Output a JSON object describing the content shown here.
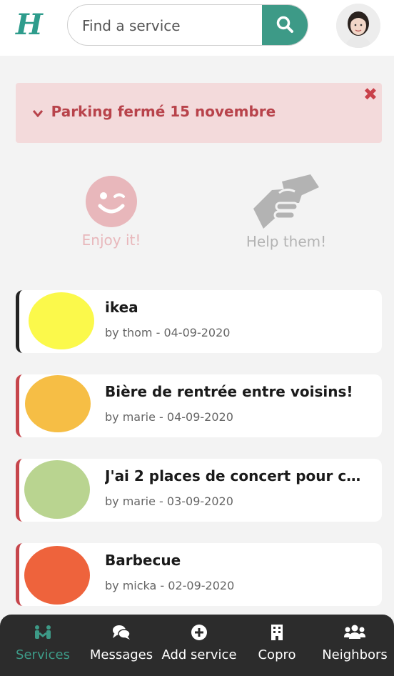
{
  "header": {
    "logo_text": "H",
    "search": {
      "placeholder": "Find a service",
      "value": ""
    },
    "search_icon": "search-icon",
    "avatar": "user-avatar"
  },
  "alert": {
    "text": "Parking fermé 15 novembre",
    "chevron": "❯",
    "close": "✖",
    "bg_color": "#f3dadb",
    "text_color": "#b8434b"
  },
  "actions": [
    {
      "label": "Enjoy it!",
      "icon": "smile-wink-icon",
      "color": "#e8b7bb"
    },
    {
      "label": "Help them!",
      "icon": "handshake-icon",
      "color": "#b3b3b3"
    }
  ],
  "services": [
    {
      "title": "ikea",
      "meta": "by thom - 04-09-2020",
      "blob_color": "#fbf94b",
      "bar_color": "#222222"
    },
    {
      "title": "Bière de rentrée entre voisins!",
      "meta": "by marie - 04-09-2020",
      "blob_color": "#f6be45",
      "bar_color": "#c6454b"
    },
    {
      "title": "J'ai 2 places de concert pour ce ...",
      "meta": "by marie - 03-09-2020",
      "blob_color": "#b9d490",
      "bar_color": "#c6454b"
    },
    {
      "title": "Barbecue",
      "meta": "by micka - 02-09-2020",
      "blob_color": "#ee633c",
      "bar_color": "#c6454b"
    }
  ],
  "nav": {
    "items": [
      {
        "label": "Services",
        "icon": "services-icon",
        "active": true
      },
      {
        "label": "Messages",
        "icon": "comments-icon",
        "active": false
      },
      {
        "label": "Add service",
        "icon": "plus-circle-icon",
        "active": false
      },
      {
        "label": "Copro",
        "icon": "building-icon",
        "active": false
      },
      {
        "label": "Neighbors",
        "icon": "users-icon",
        "active": false
      }
    ],
    "accent": "#3d9a87",
    "bg": "#2c2c2c"
  }
}
